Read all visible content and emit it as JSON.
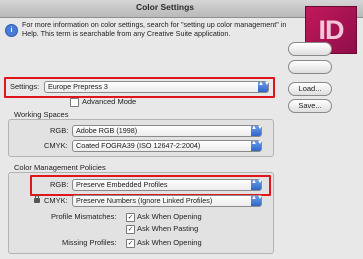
{
  "window": {
    "title": "Color Settings"
  },
  "info": {
    "text": "For more information on color settings, search for \"setting up color management\" in Help. This term is searchable from any Creative Suite application."
  },
  "settings": {
    "label": "Settings:",
    "value": "Europe Prepress 3"
  },
  "advanced_mode": {
    "label": "Advanced Mode",
    "checked": false
  },
  "working_spaces": {
    "title": "Working Spaces",
    "rgb": {
      "label": "RGB:",
      "value": "Adobe RGB (1998)"
    },
    "cmyk": {
      "label": "CMYK:",
      "value": "Coated FOGRA39 (ISO 12647-2:2004)"
    }
  },
  "policies": {
    "title": "Color Management Policies",
    "rgb": {
      "label": "RGB:",
      "value": "Preserve Embedded Profiles"
    },
    "cmyk": {
      "label": "CMYK:",
      "value": "Preserve Numbers (Ignore Linked Profiles)"
    },
    "profile_mismatches": {
      "label": "Profile Mismatches:",
      "ask_opening": {
        "label": "Ask When Opening",
        "checked": true
      },
      "ask_pasting": {
        "label": "Ask When Pasting",
        "checked": true
      }
    },
    "missing_profiles": {
      "label": "Missing Profiles:",
      "ask_opening": {
        "label": "Ask When Opening",
        "checked": true
      }
    }
  },
  "buttons": {
    "load": "Load...",
    "save": "Save..."
  },
  "logo": {
    "text": "ID",
    "color": "#c2185b"
  },
  "highlight_color": "#e0161b",
  "glyphs": {
    "check": "✓",
    "arrows": "▲▼",
    "info": "i"
  }
}
